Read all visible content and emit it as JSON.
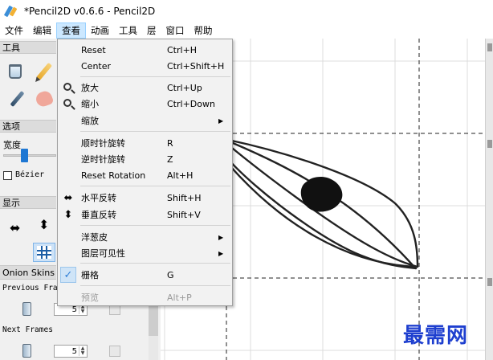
{
  "window": {
    "title": "*Pencil2D v0.6.6 - Pencil2D"
  },
  "menubar": {
    "items": [
      "文件",
      "编辑",
      "查看",
      "动画",
      "工具",
      "层",
      "窗口",
      "帮助"
    ],
    "active": "查看"
  },
  "panels": {
    "tools": {
      "title": "工具"
    },
    "options": {
      "title": "选项",
      "width_label": "宽度",
      "bezier_label": "Bézier",
      "bezier_checked": false,
      "width_level": 0.35
    },
    "display": {
      "title": "显示"
    },
    "onion": {
      "title": "Onion Skins",
      "previous_label": "Previous Fram",
      "previous_value": "5",
      "next_label": "Next Frames",
      "next_value": "5"
    }
  },
  "view_menu": {
    "items": [
      {
        "label": "Reset",
        "shortcut": "Ctrl+H",
        "icon": ""
      },
      {
        "label": "Center",
        "shortcut": "Ctrl+Shift+H",
        "icon": ""
      },
      {
        "label": "放大",
        "shortcut": "Ctrl+Up",
        "icon": "zoom-in-icon"
      },
      {
        "label": "缩小",
        "shortcut": "Ctrl+Down",
        "icon": "zoom-out-icon"
      },
      {
        "label": "缩放",
        "shortcut": "",
        "submenu": true
      },
      {
        "label": "顺时针旋转",
        "shortcut": "R"
      },
      {
        "label": "逆时针旋转",
        "shortcut": "Z"
      },
      {
        "label": "Reset Rotation",
        "shortcut": "Alt+H"
      },
      {
        "label": "水平反转",
        "shortcut": "Shift+H",
        "icon": "flip-horizontal-icon"
      },
      {
        "label": "垂直反转",
        "shortcut": "Shift+V",
        "icon": "flip-vertical-icon"
      },
      {
        "label": "洋葱皮",
        "shortcut": "",
        "submenu": true
      },
      {
        "label": "图层可见性",
        "shortcut": "",
        "submenu": true
      },
      {
        "label": "栅格",
        "shortcut": "G",
        "checked": true
      },
      {
        "label": "预览",
        "shortcut": "Alt+P",
        "disabled": true
      }
    ]
  },
  "watermark": "最需网",
  "colors": {
    "accent": "#cce8ff",
    "slider": "#1e77d3",
    "watermark": "#1e3fcf"
  }
}
